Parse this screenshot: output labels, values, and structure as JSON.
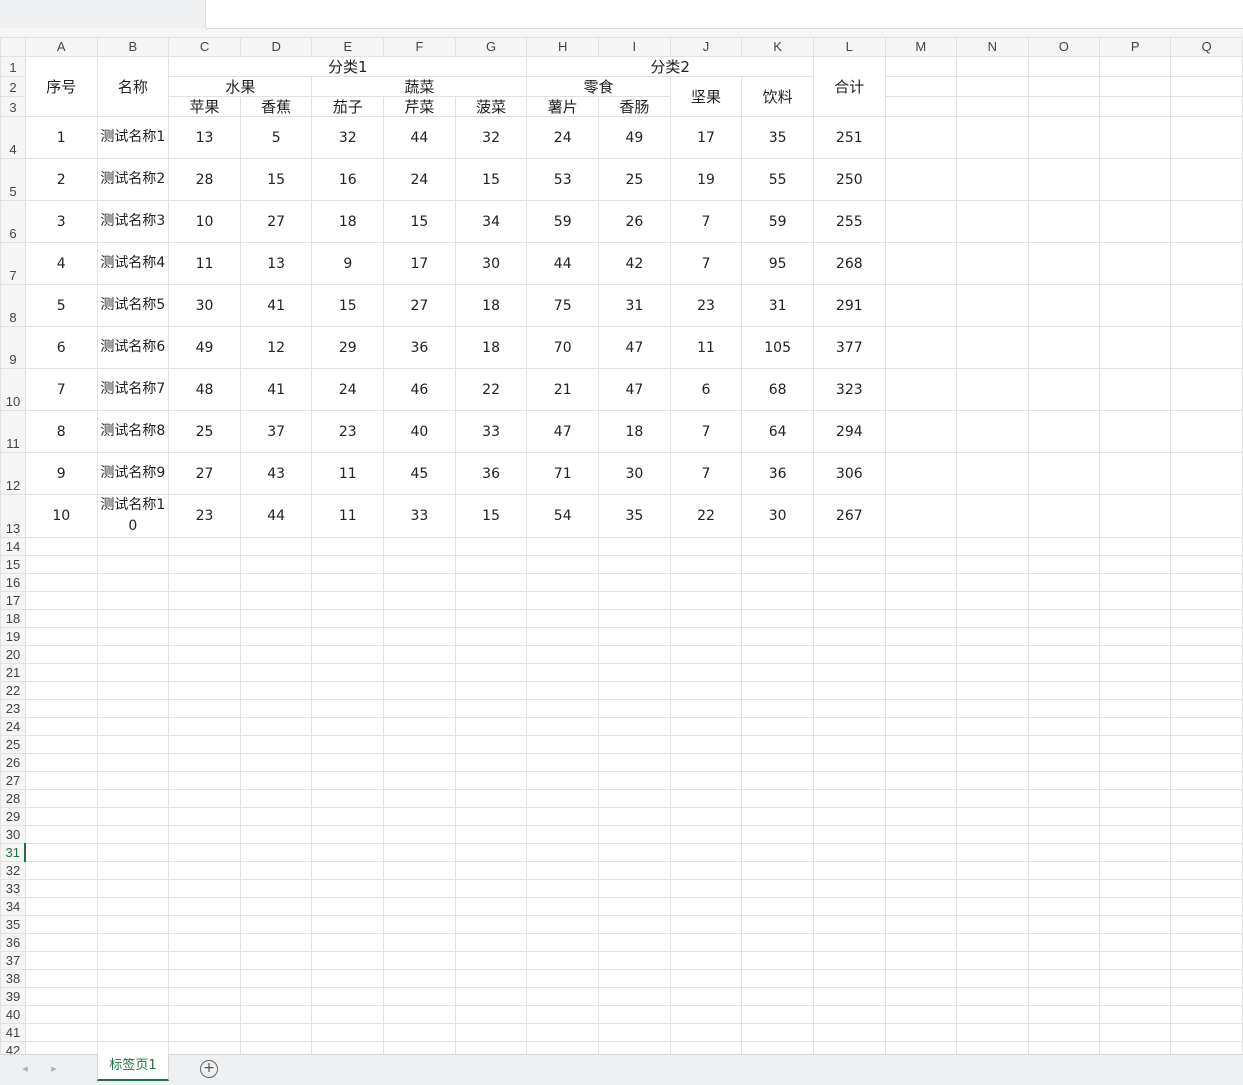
{
  "columns": [
    "A",
    "B",
    "C",
    "D",
    "E",
    "F",
    "G",
    "H",
    "I",
    "J",
    "K",
    "L",
    "M",
    "N",
    "O",
    "P",
    "Q"
  ],
  "header": {
    "seq": "序号",
    "name": "名称",
    "cat1": "分类1",
    "cat2": "分类2",
    "fruit": "水果",
    "veg": "蔬菜",
    "snack": "零食",
    "nuts": "坚果",
    "drink": "饮料",
    "total": "合计",
    "apple": "苹果",
    "banana": "香蕉",
    "eggplant": "茄子",
    "celery": "芹菜",
    "spinach": "菠菜",
    "chips": "薯片",
    "sausage": "香肠"
  },
  "rows": [
    {
      "seq": "1",
      "name": "测试名称1",
      "apple": "13",
      "banana": "5",
      "eggplant": "32",
      "celery": "44",
      "spinach": "32",
      "chips": "24",
      "sausage": "49",
      "nuts": "17",
      "drink": "35",
      "total": "251"
    },
    {
      "seq": "2",
      "name": "测试名称2",
      "apple": "28",
      "banana": "15",
      "eggplant": "16",
      "celery": "24",
      "spinach": "15",
      "chips": "53",
      "sausage": "25",
      "nuts": "19",
      "drink": "55",
      "total": "250"
    },
    {
      "seq": "3",
      "name": "测试名称3",
      "apple": "10",
      "banana": "27",
      "eggplant": "18",
      "celery": "15",
      "spinach": "34",
      "chips": "59",
      "sausage": "26",
      "nuts": "7",
      "drink": "59",
      "total": "255"
    },
    {
      "seq": "4",
      "name": "测试名称4",
      "apple": "11",
      "banana": "13",
      "eggplant": "9",
      "celery": "17",
      "spinach": "30",
      "chips": "44",
      "sausage": "42",
      "nuts": "7",
      "drink": "95",
      "total": "268"
    },
    {
      "seq": "5",
      "name": "测试名称5",
      "apple": "30",
      "banana": "41",
      "eggplant": "15",
      "celery": "27",
      "spinach": "18",
      "chips": "75",
      "sausage": "31",
      "nuts": "23",
      "drink": "31",
      "total": "291"
    },
    {
      "seq": "6",
      "name": "测试名称6",
      "apple": "49",
      "banana": "12",
      "eggplant": "29",
      "celery": "36",
      "spinach": "18",
      "chips": "70",
      "sausage": "47",
      "nuts": "11",
      "drink": "105",
      "total": "377"
    },
    {
      "seq": "7",
      "name": "测试名称7",
      "apple": "48",
      "banana": "41",
      "eggplant": "24",
      "celery": "46",
      "spinach": "22",
      "chips": "21",
      "sausage": "47",
      "nuts": "6",
      "drink": "68",
      "total": "323"
    },
    {
      "seq": "8",
      "name": "测试名称8",
      "apple": "25",
      "banana": "37",
      "eggplant": "23",
      "celery": "40",
      "spinach": "33",
      "chips": "47",
      "sausage": "18",
      "nuts": "7",
      "drink": "64",
      "total": "294"
    },
    {
      "seq": "9",
      "name": "测试名称9",
      "apple": "27",
      "banana": "43",
      "eggplant": "11",
      "celery": "45",
      "spinach": "36",
      "chips": "71",
      "sausage": "30",
      "nuts": "7",
      "drink": "36",
      "total": "306"
    },
    {
      "seq": "10",
      "name": "测试名称10",
      "apple": "23",
      "banana": "44",
      "eggplant": "11",
      "celery": "33",
      "spinach": "15",
      "chips": "54",
      "sausage": "35",
      "nuts": "22",
      "drink": "30",
      "total": "267"
    }
  ],
  "row_numbers": [
    "1",
    "2",
    "3",
    "4",
    "5",
    "6",
    "7",
    "8",
    "9",
    "10",
    "11",
    "12",
    "13",
    "14",
    "15",
    "16",
    "17",
    "18",
    "19",
    "20",
    "21",
    "22",
    "23",
    "24",
    "25",
    "26",
    "27",
    "28",
    "29",
    "30",
    "31",
    "32",
    "33",
    "34",
    "35",
    "36",
    "37",
    "38",
    "39",
    "40",
    "41",
    "42"
  ],
  "active_row": "31",
  "sheet_tab": "标签页1",
  "accent_color": "#1e7145"
}
